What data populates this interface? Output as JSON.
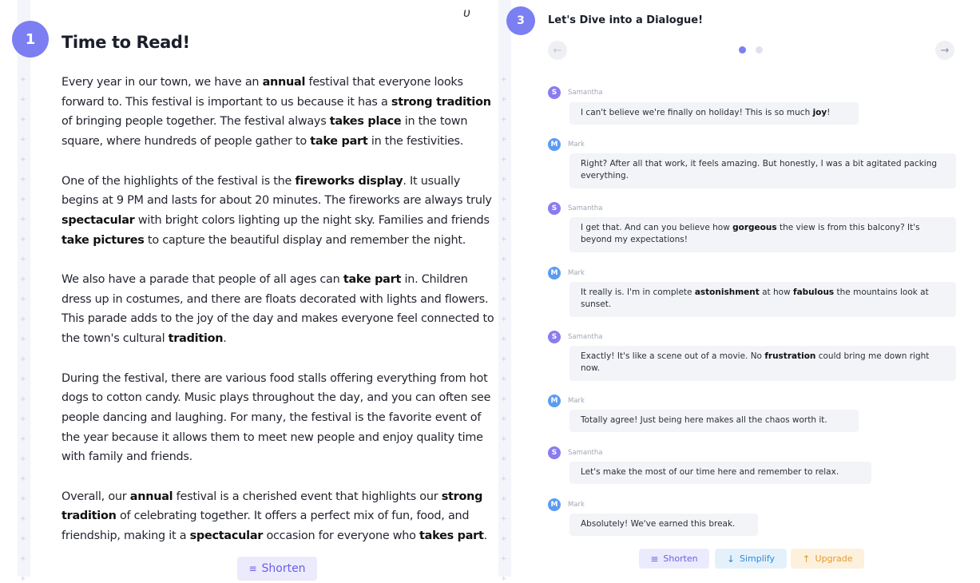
{
  "reading": {
    "step": "1",
    "title": "Time to Read!",
    "paragraphs": [
      [
        {
          "t": "Every year in our town, we have an "
        },
        {
          "t": "annual",
          "b": true
        },
        {
          "t": " festival that everyone looks forward to. This festival is important to us because it has a "
        },
        {
          "t": "strong tradition",
          "b": true
        },
        {
          "t": " of bringing people together. The festival always "
        },
        {
          "t": "takes place",
          "b": true
        },
        {
          "t": " in the town square, where hundreds of people gather to "
        },
        {
          "t": "take part",
          "b": true
        },
        {
          "t": " in the festivities."
        }
      ],
      [
        {
          "t": "One of the highlights of the festival is the "
        },
        {
          "t": "fireworks display",
          "b": true
        },
        {
          "t": ". It usually begins at 9 PM and lasts for about 20 minutes. The fireworks are always truly "
        },
        {
          "t": "spectacular",
          "b": true
        },
        {
          "t": " with bright colors lighting up the night sky. Families and friends "
        },
        {
          "t": "take pictures",
          "b": true
        },
        {
          "t": " to capture the beautiful display and remember the night."
        }
      ],
      [
        {
          "t": "We also have a parade that people of all ages can "
        },
        {
          "t": "take part",
          "b": true
        },
        {
          "t": " in. Children dress up in costumes, and there are floats decorated with lights and flowers. This parade adds to the joy of the day and makes everyone feel connected to the town's cultural "
        },
        {
          "t": "tradition",
          "b": true
        },
        {
          "t": "."
        }
      ],
      [
        {
          "t": "During the festival, there are various food stalls offering everything from hot dogs to cotton candy. Music plays throughout the day, and you can often see people dancing and laughing. For many, the festival is the favorite event of the year because it allows them to meet new people and enjoy quality time with family and friends."
        }
      ],
      [
        {
          "t": "Overall, our "
        },
        {
          "t": "annual",
          "b": true
        },
        {
          "t": " festival is a cherished event that highlights our "
        },
        {
          "t": "strong tradition",
          "b": true
        },
        {
          "t": " of celebrating together. It offers a perfect mix of fun, food, and friendship, making it a "
        },
        {
          "t": "spectacular",
          "b": true
        },
        {
          "t": " occasion for everyone who "
        },
        {
          "t": "takes part",
          "b": true
        },
        {
          "t": "."
        }
      ]
    ],
    "shorten_label": "Shorten"
  },
  "dialogue": {
    "step": "3",
    "title": "Let's Dive into a Dialogue!",
    "prev_icon": "arrow-left-icon",
    "next_icon": "arrow-right-icon",
    "prev_glyph": "←",
    "next_glyph": "→",
    "messages": [
      {
        "speaker": "Samantha",
        "initial": "S",
        "parts": [
          {
            "t": "I can't believe we're finally on holiday! This is so much "
          },
          {
            "t": "joy",
            "b": true
          },
          {
            "t": "!"
          }
        ]
      },
      {
        "speaker": "Mark",
        "initial": "M",
        "parts": [
          {
            "t": "Right? After all that work, it feels amazing. But honestly, I was a bit agitated packing everything."
          }
        ]
      },
      {
        "speaker": "Samantha",
        "initial": "S",
        "parts": [
          {
            "t": "I get that. And can you believe how "
          },
          {
            "t": "gorgeous",
            "b": true
          },
          {
            "t": " the view is from this balcony? It's beyond my expectations!"
          }
        ]
      },
      {
        "speaker": "Mark",
        "initial": "M",
        "parts": [
          {
            "t": "It really is. I'm in complete "
          },
          {
            "t": "astonishment",
            "b": true
          },
          {
            "t": " at how "
          },
          {
            "t": "fabulous",
            "b": true
          },
          {
            "t": " the mountains look at sunset."
          }
        ]
      },
      {
        "speaker": "Samantha",
        "initial": "S",
        "parts": [
          {
            "t": "Exactly! It's like a scene out of a movie. No "
          },
          {
            "t": "frustration",
            "b": true
          },
          {
            "t": " could bring me down right now."
          }
        ]
      },
      {
        "speaker": "Mark",
        "initial": "M",
        "parts": [
          {
            "t": "Totally agree! Just being here makes all the chaos worth it."
          }
        ]
      },
      {
        "speaker": "Samantha",
        "initial": "S",
        "parts": [
          {
            "t": "Let's make the most of our time here and remember to relax."
          }
        ]
      },
      {
        "speaker": "Mark",
        "initial": "M",
        "parts": [
          {
            "t": "Absolutely! We've earned this break."
          }
        ]
      }
    ],
    "actions": {
      "shorten_label": "Shorten",
      "simplify_label": "Simplify",
      "upgrade_label": "Upgrade"
    }
  },
  "colors": {
    "accent": "#7b7ff2",
    "samantha_avatar": "#8a7cf0",
    "mark_avatar": "#5b9cf2"
  }
}
